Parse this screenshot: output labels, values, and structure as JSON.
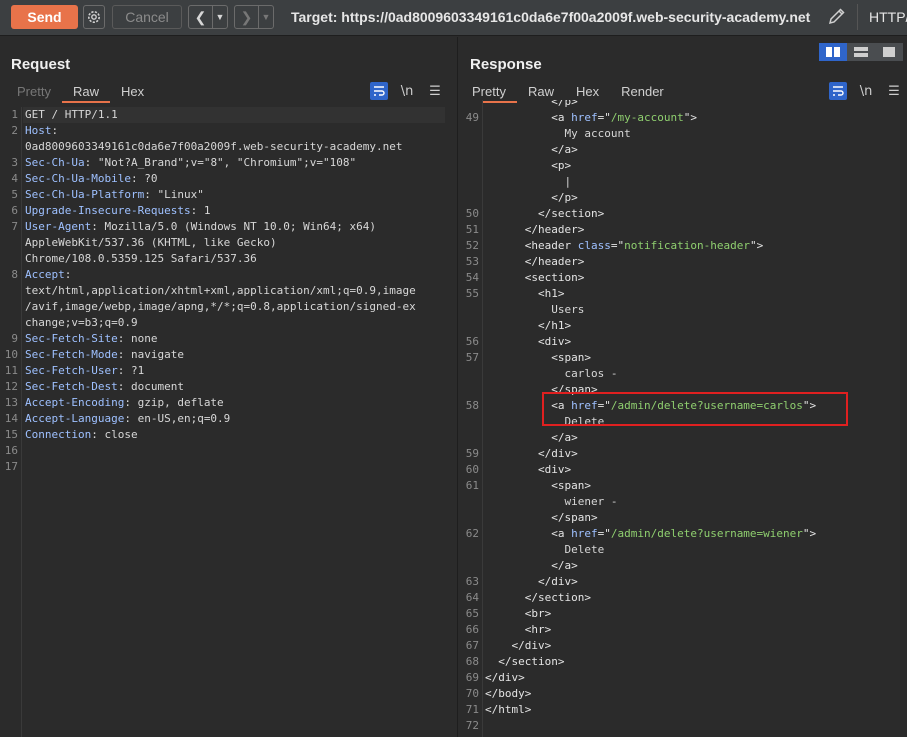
{
  "toolbar": {
    "send_label": "Send",
    "cancel_label": "Cancel",
    "target_text": "Target: https://0ad8009603349161c0da6e7f00a2009f.web-security-academy.net",
    "http_label": "HTTP/"
  },
  "request": {
    "title": "Request",
    "tabs": [
      "Pretty",
      "Raw",
      "Hex"
    ],
    "active_tab": "Raw"
  },
  "response": {
    "title": "Response",
    "tabs": [
      "Pretty",
      "Raw",
      "Hex",
      "Render"
    ],
    "active_tab": "Pretty"
  },
  "request_lines": [
    {
      "n": "1",
      "parts": [
        [
          "",
          "GET / HTTP/1.1"
        ]
      ]
    },
    {
      "n": "2",
      "parts": [
        [
          "hk",
          "Host"
        ],
        [
          "",
          ":"
        ]
      ]
    },
    {
      "n": "",
      "parts": [
        [
          "",
          "0ad8009603349161c0da6e7f00a2009f.web-security-academy.net"
        ]
      ]
    },
    {
      "n": "3",
      "parts": [
        [
          "hk",
          "Sec-Ch-Ua"
        ],
        [
          "",
          ": \"Not?A_Brand\";v=\"8\", \"Chromium\";v=\"108\""
        ]
      ]
    },
    {
      "n": "4",
      "parts": [
        [
          "hk",
          "Sec-Ch-Ua-Mobile"
        ],
        [
          "",
          ": ?0"
        ]
      ]
    },
    {
      "n": "5",
      "parts": [
        [
          "hk",
          "Sec-Ch-Ua-Platform"
        ],
        [
          "",
          ": \"Linux\""
        ]
      ]
    },
    {
      "n": "6",
      "parts": [
        [
          "hk",
          "Upgrade-Insecure-Requests"
        ],
        [
          "",
          ": 1"
        ]
      ]
    },
    {
      "n": "7",
      "parts": [
        [
          "hk",
          "User-Agent"
        ],
        [
          "",
          ": Mozilla/5.0 (Windows NT 10.0; Win64; x64)"
        ]
      ]
    },
    {
      "n": "",
      "parts": [
        [
          "",
          "AppleWebKit/537.36 (KHTML, like Gecko)"
        ]
      ]
    },
    {
      "n": "",
      "parts": [
        [
          "",
          "Chrome/108.0.5359.125 Safari/537.36"
        ]
      ]
    },
    {
      "n": "8",
      "parts": [
        [
          "hk",
          "Accept"
        ],
        [
          "",
          ":"
        ]
      ]
    },
    {
      "n": "",
      "parts": [
        [
          "",
          "text/html,application/xhtml+xml,application/xml;q=0.9,image"
        ]
      ]
    },
    {
      "n": "",
      "parts": [
        [
          "",
          "/avif,image/webp,image/apng,*/*;q=0.8,application/signed-ex"
        ]
      ]
    },
    {
      "n": "",
      "parts": [
        [
          "",
          "change;v=b3;q=0.9"
        ]
      ]
    },
    {
      "n": "9",
      "parts": [
        [
          "hk",
          "Sec-Fetch-Site"
        ],
        [
          "",
          ": none"
        ]
      ]
    },
    {
      "n": "10",
      "parts": [
        [
          "hk",
          "Sec-Fetch-Mode"
        ],
        [
          "",
          ": navigate"
        ]
      ]
    },
    {
      "n": "11",
      "parts": [
        [
          "hk",
          "Sec-Fetch-User"
        ],
        [
          "",
          ": ?1"
        ]
      ]
    },
    {
      "n": "12",
      "parts": [
        [
          "hk",
          "Sec-Fetch-Dest"
        ],
        [
          "",
          ": document"
        ]
      ]
    },
    {
      "n": "13",
      "parts": [
        [
          "hk",
          "Accept-Encoding"
        ],
        [
          "",
          ": gzip, deflate"
        ]
      ]
    },
    {
      "n": "14",
      "parts": [
        [
          "hk",
          "Accept-Language"
        ],
        [
          "",
          ": en-US,en;q=0.9"
        ]
      ]
    },
    {
      "n": "15",
      "parts": [
        [
          "hk",
          "Connection"
        ],
        [
          "",
          ": close"
        ]
      ]
    },
    {
      "n": "16",
      "parts": []
    },
    {
      "n": "17",
      "parts": []
    }
  ],
  "response_lines": [
    {
      "n": "",
      "parts": [
        [
          "",
          "          "
        ],
        [
          "tag",
          "</p>"
        ]
      ]
    },
    {
      "n": "49",
      "parts": [
        [
          "",
          "          "
        ],
        [
          "tag",
          "<a "
        ],
        [
          "attr",
          "href"
        ],
        [
          "tag",
          "=\""
        ],
        [
          "str",
          "/my-account"
        ],
        [
          "tag",
          "\">"
        ]
      ]
    },
    {
      "n": "",
      "parts": [
        [
          "",
          "            My account"
        ]
      ]
    },
    {
      "n": "",
      "parts": [
        [
          "",
          "          "
        ],
        [
          "tag",
          "</a>"
        ]
      ]
    },
    {
      "n": "",
      "parts": [
        [
          "",
          "          "
        ],
        [
          "tag",
          "<p>"
        ]
      ]
    },
    {
      "n": "",
      "parts": [
        [
          "",
          "            |"
        ]
      ]
    },
    {
      "n": "",
      "parts": [
        [
          "",
          "          "
        ],
        [
          "tag",
          "</p>"
        ]
      ]
    },
    {
      "n": "50",
      "parts": [
        [
          "",
          "        "
        ],
        [
          "tag",
          "</section>"
        ]
      ]
    },
    {
      "n": "51",
      "parts": [
        [
          "",
          "      "
        ],
        [
          "tag",
          "</header>"
        ]
      ]
    },
    {
      "n": "52",
      "parts": [
        [
          "",
          "      "
        ],
        [
          "tag",
          "<header "
        ],
        [
          "attr",
          "class"
        ],
        [
          "tag",
          "=\""
        ],
        [
          "str",
          "notification-header"
        ],
        [
          "tag",
          "\">"
        ]
      ]
    },
    {
      "n": "53",
      "parts": [
        [
          "",
          "      "
        ],
        [
          "tag",
          "</header>"
        ]
      ]
    },
    {
      "n": "54",
      "parts": [
        [
          "",
          "      "
        ],
        [
          "tag",
          "<section>"
        ]
      ]
    },
    {
      "n": "55",
      "parts": [
        [
          "",
          "        "
        ],
        [
          "tag",
          "<h1>"
        ]
      ]
    },
    {
      "n": "",
      "parts": [
        [
          "",
          "          Users"
        ]
      ]
    },
    {
      "n": "",
      "parts": [
        [
          "",
          "        "
        ],
        [
          "tag",
          "</h1>"
        ]
      ]
    },
    {
      "n": "56",
      "parts": [
        [
          "",
          "        "
        ],
        [
          "tag",
          "<div>"
        ]
      ]
    },
    {
      "n": "57",
      "parts": [
        [
          "",
          "          "
        ],
        [
          "tag",
          "<span>"
        ]
      ]
    },
    {
      "n": "",
      "parts": [
        [
          "",
          "            carlos -"
        ]
      ]
    },
    {
      "n": "",
      "parts": [
        [
          "",
          "          "
        ],
        [
          "tag",
          "</span>"
        ]
      ]
    },
    {
      "n": "58",
      "parts": [
        [
          "",
          "          "
        ],
        [
          "tag",
          "<a "
        ],
        [
          "attr",
          "href"
        ],
        [
          "tag",
          "=\""
        ],
        [
          "str",
          "/admin/delete?username=carlos"
        ],
        [
          "tag",
          "\">"
        ]
      ]
    },
    {
      "n": "",
      "parts": [
        [
          "",
          "            Delete"
        ]
      ]
    },
    {
      "n": "",
      "parts": [
        [
          "",
          "          "
        ],
        [
          "tag",
          "</a>"
        ]
      ]
    },
    {
      "n": "59",
      "parts": [
        [
          "",
          "        "
        ],
        [
          "tag",
          "</div>"
        ]
      ]
    },
    {
      "n": "60",
      "parts": [
        [
          "",
          "        "
        ],
        [
          "tag",
          "<div>"
        ]
      ]
    },
    {
      "n": "61",
      "parts": [
        [
          "",
          "          "
        ],
        [
          "tag",
          "<span>"
        ]
      ]
    },
    {
      "n": "",
      "parts": [
        [
          "",
          "            wiener -"
        ]
      ]
    },
    {
      "n": "",
      "parts": [
        [
          "",
          "          "
        ],
        [
          "tag",
          "</span>"
        ]
      ]
    },
    {
      "n": "62",
      "parts": [
        [
          "",
          "          "
        ],
        [
          "tag",
          "<a "
        ],
        [
          "attr",
          "href"
        ],
        [
          "tag",
          "=\""
        ],
        [
          "str",
          "/admin/delete?username=wiener"
        ],
        [
          "tag",
          "\">"
        ]
      ]
    },
    {
      "n": "",
      "parts": [
        [
          "",
          "            Delete"
        ]
      ]
    },
    {
      "n": "",
      "parts": [
        [
          "",
          "          "
        ],
        [
          "tag",
          "</a>"
        ]
      ]
    },
    {
      "n": "63",
      "parts": [
        [
          "",
          "        "
        ],
        [
          "tag",
          "</div>"
        ]
      ]
    },
    {
      "n": "64",
      "parts": [
        [
          "",
          "      "
        ],
        [
          "tag",
          "</section>"
        ]
      ]
    },
    {
      "n": "65",
      "parts": [
        [
          "",
          "      "
        ],
        [
          "tag",
          "<br>"
        ]
      ]
    },
    {
      "n": "66",
      "parts": [
        [
          "",
          "      "
        ],
        [
          "tag",
          "<hr>"
        ]
      ]
    },
    {
      "n": "67",
      "parts": [
        [
          "",
          "    "
        ],
        [
          "tag",
          "</div>"
        ]
      ]
    },
    {
      "n": "68",
      "parts": [
        [
          "",
          "  "
        ],
        [
          "tag",
          "</section>"
        ]
      ]
    },
    {
      "n": "69",
      "parts": [
        [
          "tag",
          "</div>"
        ]
      ]
    },
    {
      "n": "70",
      "parts": [
        [
          "tag",
          "</body>"
        ]
      ]
    },
    {
      "n": "71",
      "parts": [
        [
          "tag",
          "</html>"
        ]
      ]
    },
    {
      "n": "72",
      "parts": []
    }
  ],
  "colors": {
    "accent": "#e8734a",
    "highlight_box": "#e02020",
    "selected_blue": "#2f65ca"
  }
}
